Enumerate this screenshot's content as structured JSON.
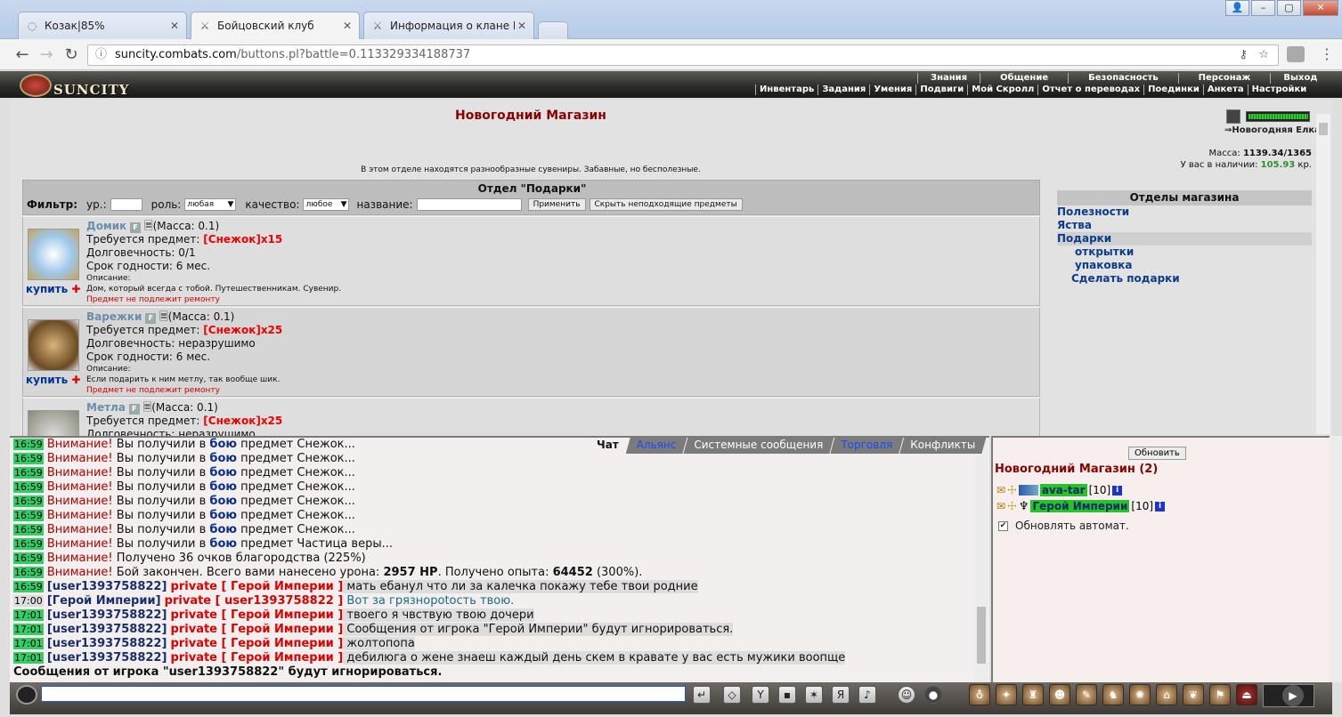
{
  "browser": {
    "tabs": [
      {
        "title": "Козак|85%",
        "icon": "spinner-icon"
      },
      {
        "title": "Бойцовский клуб",
        "icon": "swords-icon"
      },
      {
        "title": "Информация о клане N",
        "icon": "swords-icon"
      }
    ],
    "url_host": "suncity.combats.com",
    "url_path": "/buttons.pl?battle=0.113329334188737"
  },
  "game": {
    "logo": "SUNCITY",
    "menu_top": [
      "Знания",
      "Общение",
      "Безопасность",
      "Персонаж",
      "Выход"
    ],
    "menu_sub": [
      "Инвентарь",
      "Задания",
      "Умения",
      "Подвиги",
      "Мой Скролл",
      "Отчет о переводах",
      "Поединки",
      "Анкета",
      "Настройки"
    ]
  },
  "shop": {
    "title": "Новогодний Магазин",
    "tree_label": "Новогодняя Елка",
    "description": "В этом отделе находятся разнообразные сувениры. Забавные, но бесполезные.",
    "mass_label": "Масса:",
    "mass_value": "1139.34/1365",
    "money_label": "У вас в наличии:",
    "money_value": "105.93",
    "money_unit": "кр.",
    "dept_title": "Отдел \"Подарки\"",
    "filter": {
      "label": "Фильтр:",
      "level": "ур.:",
      "role": "роль:",
      "role_value": "любая",
      "quality": "качество:",
      "quality_value": "любое",
      "name": "название:",
      "apply": "Применить",
      "hide": "Скрыть неподходящие предметы"
    },
    "buy_label": "купить",
    "items": [
      {
        "name": "Домик",
        "mass": "(Масса: 0.1)",
        "req_label": "Требуется предмет:",
        "req": "[Снежок]x15",
        "durability": "Долговечность: 0/1",
        "expiry": "Срок годности: 6 мес.",
        "desc_label": "Описание:",
        "desc": "Дом, который всегда с тобой. Путешественникам. Сувенир.",
        "repair": "Предмет не подлежит ремонту"
      },
      {
        "name": "Варежки",
        "mass": "(Масса: 0.1)",
        "req_label": "Требуется предмет:",
        "req": "[Снежок]x25",
        "durability": "Долговечность: неразрушимо",
        "expiry": "Срок годности: 6 мес.",
        "desc_label": "Описание:",
        "desc": "Если подарить к ним метлу, так вообще шик.",
        "repair": "Предмет не подлежит ремонту"
      },
      {
        "name": "Метла",
        "mass": "(Масса: 0.1)",
        "req_label": "Требуется предмет:",
        "req": "[Снежок]x25",
        "durability": "Долговечность: неразрушимо",
        "expiry": "",
        "desc_label": "",
        "desc": "",
        "repair": ""
      }
    ],
    "departments_title": "Отделы магазина",
    "departments": [
      "Полезности",
      "Яства",
      "Подарки",
      "открытки",
      "упаковка",
      "Сделать подарки"
    ]
  },
  "chat": {
    "tabs": [
      "Чат",
      "Альянс",
      "Системные сообщения",
      "Торговля",
      "Конфликты"
    ],
    "lines": [
      {
        "time": "16:59",
        "type": "sys",
        "a": "Внимание!",
        "b": " Вы получили в ",
        "c": "бою",
        "d": " предмет Снежок..."
      },
      {
        "time": "16:59",
        "type": "sys",
        "a": "Внимание!",
        "b": " Вы получили в ",
        "c": "бою",
        "d": " предмет Снежок..."
      },
      {
        "time": "16:59",
        "type": "sys",
        "a": "Внимание!",
        "b": " Вы получили в ",
        "c": "бою",
        "d": " предмет Снежок..."
      },
      {
        "time": "16:59",
        "type": "sys",
        "a": "Внимание!",
        "b": " Вы получили в ",
        "c": "бою",
        "d": " предмет Снежок..."
      },
      {
        "time": "16:59",
        "type": "sys",
        "a": "Внимание!",
        "b": " Вы получили в ",
        "c": "бою",
        "d": " предмет Снежок..."
      },
      {
        "time": "16:59",
        "type": "sys",
        "a": "Внимание!",
        "b": " Вы получили в ",
        "c": "бою",
        "d": " предмет Снежок..."
      },
      {
        "time": "16:59",
        "type": "sys",
        "a": "Внимание!",
        "b": " Вы получили в ",
        "c": "бою",
        "d": " предмет Снежок..."
      },
      {
        "time": "16:59",
        "type": "sys",
        "a": "Внимание!",
        "b": " Вы получили в ",
        "c": "бою",
        "d": " предмет Частица веры..."
      },
      {
        "time": "16:59",
        "type": "sys2",
        "a": "Внимание!",
        "b": " Получено 36 очков благородства (225%)"
      },
      {
        "time": "16:59",
        "type": "sys3",
        "a": "Внимание!",
        "b": " Бой закончен. Всего вами нанесено урона: ",
        "c": "2957 HP",
        "d": ". Получено опыта: ",
        "e": "64452",
        "f": " (300%)."
      },
      {
        "time": "16:59",
        "type": "priv",
        "user": "[user1393758822]",
        "to": "private [ Герой Империи ]",
        "text": " мать ебанул что ли за калечка покажу тебе твои родние"
      },
      {
        "time": "17:00",
        "type": "privme",
        "user": "[Герой Империи]",
        "to": "private [ user1393758822 ]",
        "text": " Вот за грязнороtость твою."
      },
      {
        "time": "17:01",
        "type": "priv",
        "user": "[user1393758822]",
        "to": "private [ Герой Империи ]",
        "text": " твоего я чвствую твою дочери"
      },
      {
        "time": "17:01",
        "type": "priv",
        "user": "[user1393758822]",
        "to": "private [ Герой Империи ]",
        "text": " Сообщения от игрока \"Герой Империи\" будут игнорироваться."
      },
      {
        "time": "17:01",
        "type": "priv",
        "user": "[user1393758822]",
        "to": "private [ Герой Империи ]",
        "text": " жолтопопа"
      },
      {
        "time": "17:01",
        "type": "priv",
        "user": "[user1393758822]",
        "to": "private [ Герой Империи ]",
        "text": " дебилюга о жене знаеш каждый день скем в кравате у вас есть мужики воопще"
      },
      {
        "time": "",
        "type": "bold",
        "a": "Сообщения от игрока \"user1393758822\" будут игнорироваться."
      }
    ]
  },
  "online": {
    "refresh": "Обновить",
    "room": "Новогодний Магазин (2)",
    "users": [
      {
        "name": "ava-tar",
        "level": "[10]"
      },
      {
        "name": "Герой Империи",
        "level": "[10]"
      }
    ],
    "auto": "Обновлять автомат."
  },
  "colors": {
    "accent": "#8b0000",
    "online_green": "#27c427",
    "time_green": "#33cc66",
    "link_blue": "#0b3c8c"
  }
}
